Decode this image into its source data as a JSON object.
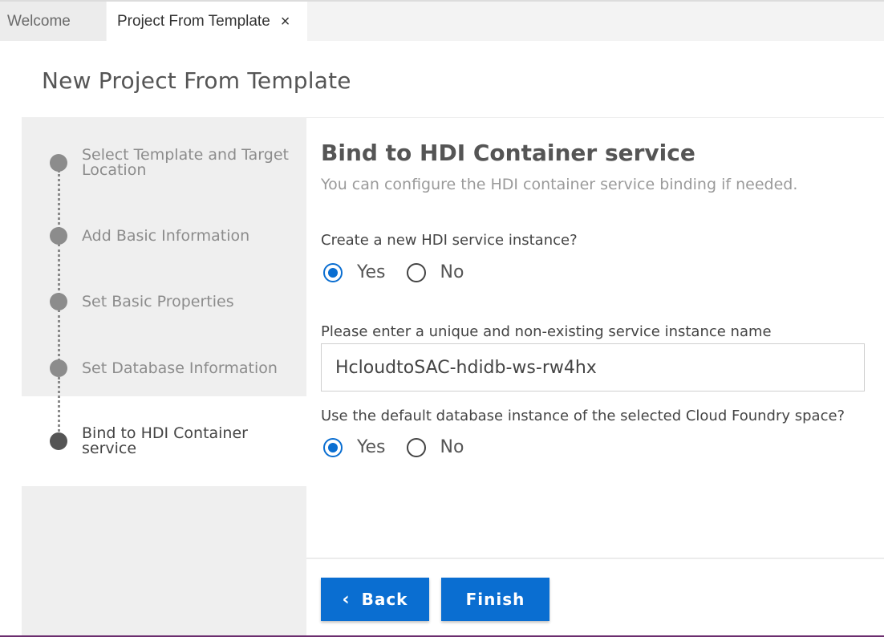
{
  "tabs": [
    {
      "label": "Welcome",
      "active": false
    },
    {
      "label": "Project From Template",
      "active": true,
      "close_icon": "close-icon",
      "close_glyph": "×"
    }
  ],
  "page_title": "New Project From Template",
  "wizard": {
    "steps": [
      {
        "label": "Select Template and Target Location",
        "state": "done"
      },
      {
        "label": "Add Basic Information",
        "state": "done"
      },
      {
        "label": "Set Basic Properties",
        "state": "done"
      },
      {
        "label": "Set Database Information",
        "state": "done"
      },
      {
        "label": "Bind to HDI Container service",
        "state": "current"
      }
    ]
  },
  "content": {
    "title": "Bind to HDI Container service",
    "subtitle": "You can configure the HDI container service binding if needed.",
    "q1": {
      "label": "Create a new HDI service instance?",
      "options": [
        "Yes",
        "No"
      ],
      "selected": "Yes"
    },
    "instance_name": {
      "label": "Please enter a unique and non-existing service instance name",
      "value": "HcloudtoSAC-hdidb-ws-rw4hx"
    },
    "q2": {
      "label": "Use the default database instance of the selected Cloud Foundry space?",
      "options": [
        "Yes",
        "No"
      ],
      "selected": "Yes"
    }
  },
  "buttons": {
    "back_label": "Back",
    "back_icon": "chevron-left-icon",
    "finish_label": "Finish"
  },
  "colors": {
    "accent": "#0a6ed1",
    "step_done": "#8c8c8c",
    "step_current": "#555555"
  }
}
